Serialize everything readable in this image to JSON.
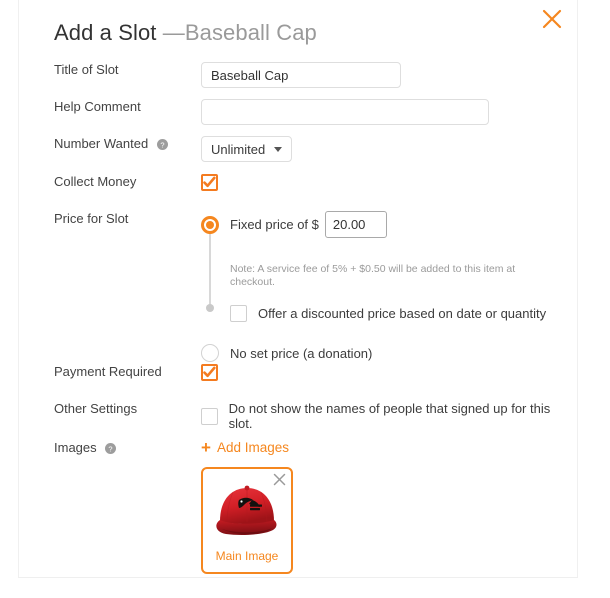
{
  "dialog": {
    "title_main": "Add a Slot ",
    "title_sep_product": "—Baseball Cap",
    "close_icon": "close-icon"
  },
  "fields": {
    "title_of_slot": {
      "label": "Title of Slot",
      "value": "Baseball Cap",
      "placeholder": ""
    },
    "help_comment": {
      "label": "Help Comment",
      "value": "",
      "placeholder": ""
    },
    "number_wanted": {
      "label": "Number Wanted",
      "help_icon": "help-icon",
      "selected": "Unlimited",
      "options": [
        "Unlimited"
      ]
    },
    "collect_money": {
      "label": "Collect Money",
      "checked": "true"
    },
    "price_for_slot": {
      "label": "Price for Slot",
      "fixed_price_label": "Fixed price of $",
      "fixed_price_value": "20.00",
      "fixed_price_selected": "true",
      "note": "Note: A service fee of 5% + $0.50 will be added to this item at checkout.",
      "discount_label": "Offer a discounted price based on date or quantity",
      "discount_checked": "false",
      "no_set_price_label": "No set price (a donation)",
      "no_set_price_selected": "false"
    },
    "payment_required": {
      "label": "Payment Required",
      "checked": "true"
    },
    "other_settings": {
      "label": "Other Settings",
      "option_label": "Do not show the names of people that signed up for this slot.",
      "checked": "false"
    },
    "images": {
      "label": "Images",
      "help_icon": "help-icon",
      "add_link": "Add Images",
      "plus": "+",
      "card": {
        "caption": "Main Image",
        "remove_icon": "close-icon",
        "alt": "red baseball cap with dark logo"
      }
    }
  },
  "colors": {
    "accent_orange": "#f5871f",
    "label_gray": "#434343",
    "muted_gray": "#9b9b9b",
    "cap_red": "#d8202a"
  }
}
